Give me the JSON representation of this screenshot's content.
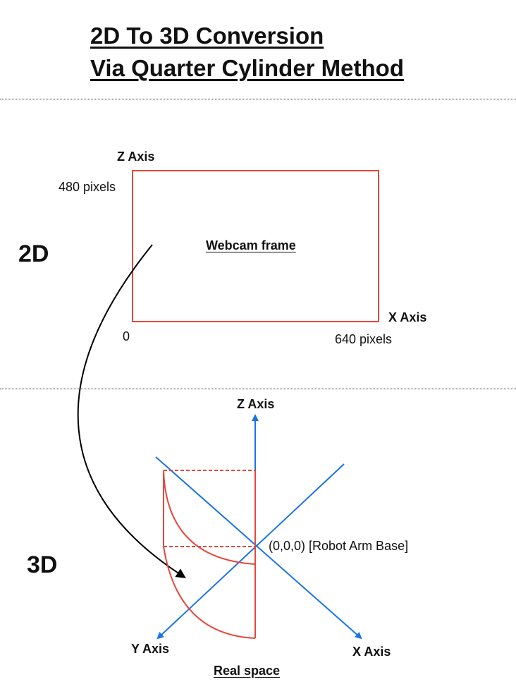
{
  "title": {
    "line1": "2D To 3D Conversion",
    "line2": "Via Quarter Cylinder Method"
  },
  "section_2d": {
    "label": "2D",
    "z_axis_label": "Z Axis",
    "z_max_label": "480 pixels",
    "origin_label": "0",
    "x_axis_label": "X Axis",
    "x_max_label": "640 pixels",
    "frame_label": "Webcam frame"
  },
  "section_3d": {
    "label": "3D",
    "z_axis_label": "Z Axis",
    "y_axis_label": "Y Axis",
    "x_axis_label": "X Axis",
    "origin_label": "(0,0,0) [Robot Arm Base]",
    "space_label": "Real space"
  },
  "colors": {
    "frame_red": "#e8463c",
    "axis_blue": "#1a73e8",
    "arrow_black": "#000000"
  }
}
